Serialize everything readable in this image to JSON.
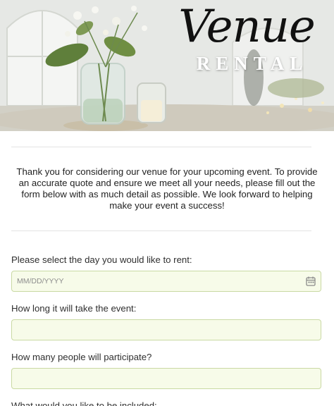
{
  "header": {
    "title_script": "Venue",
    "title_caps": "RENTAL"
  },
  "intro": {
    "text": "Thank you for considering our venue for your upcoming event. To provide an accurate quote and ensure we meet all your needs, please fill out the form below with as much detail as possible. We look forward to helping make your event a success!"
  },
  "form": {
    "date": {
      "label": "Please select the day you would like to rent:",
      "placeholder": "MM/DD/YYYY",
      "icon": "calendar-icon"
    },
    "duration": {
      "label": "How long it will take the event:",
      "value": ""
    },
    "guests": {
      "label": "How many people will participate?",
      "value": ""
    },
    "included": {
      "label": "What would you like to be included:"
    }
  },
  "colors": {
    "input_border": "#c9d9a3",
    "input_bg": "#f7fbe9",
    "text": "#2b2b2b"
  }
}
